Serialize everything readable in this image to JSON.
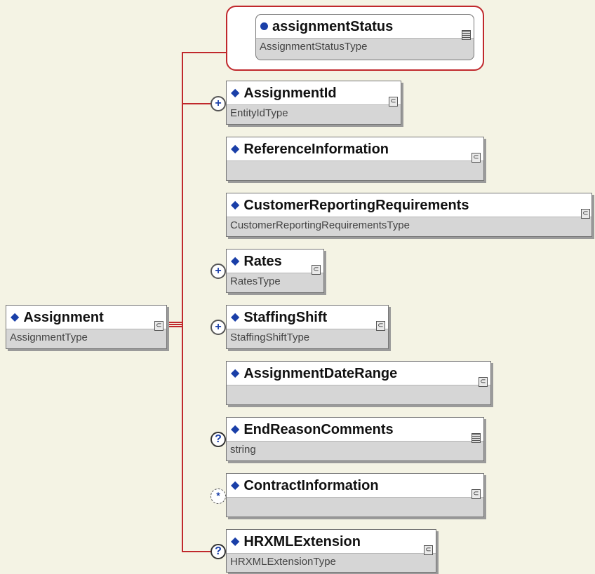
{
  "diagram": {
    "root": {
      "name": "Assignment",
      "type": "AssignmentType",
      "badge": "⊂"
    },
    "children": [
      {
        "name": "assignmentStatus",
        "type": "AssignmentStatusType",
        "marker": "",
        "badge": "≡"
      },
      {
        "name": "AssignmentId",
        "type": "EntityIdType",
        "marker": "+",
        "badge": "⊂"
      },
      {
        "name": "ReferenceInformation",
        "type": "",
        "marker": "",
        "badge": "⊂"
      },
      {
        "name": "CustomerReportingRequirements",
        "type": "CustomerReportingRequirementsType",
        "marker": "",
        "badge": "⊂"
      },
      {
        "name": "Rates",
        "type": "RatesType",
        "marker": "+",
        "badge": "⊂"
      },
      {
        "name": "StaffingShift",
        "type": "StaffingShiftType",
        "marker": "+",
        "badge": "⊂"
      },
      {
        "name": "AssignmentDateRange",
        "type": "",
        "marker": "",
        "badge": "⊂"
      },
      {
        "name": "EndReasonComments",
        "type": "string",
        "marker": "?",
        "badge": "≡"
      },
      {
        "name": "ContractInformation",
        "type": "",
        "marker": "*",
        "badge": "⊂"
      },
      {
        "name": "HRXMLExtension",
        "type": "HRXMLExtensionType",
        "marker": "?",
        "badge": "⊂"
      }
    ],
    "colors": {
      "connector": "#c0282c",
      "icon": "#1a3fa8",
      "background": "#f4f3e4"
    }
  }
}
